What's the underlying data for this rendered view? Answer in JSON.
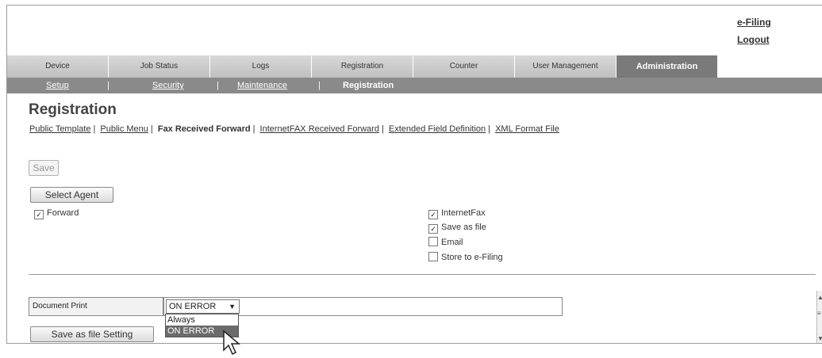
{
  "top_links": [
    "e-Filing",
    "Logout"
  ],
  "tabs": [
    "Device",
    "Job Status",
    "Logs",
    "Registration",
    "Counter",
    "User Management",
    "Administration"
  ],
  "subnav": [
    "Setup",
    "Security",
    "Maintenance",
    "Registration"
  ],
  "page_title": "Registration",
  "section_links": {
    "public_template": "Public Template",
    "public_menu": "Public Menu",
    "fax_received_forward": "Fax Received Forward",
    "internetfax_received_forward": "InternetFAX Received Forward",
    "extended_field_definition": "Extended Field Definition",
    "xml_format_file": "XML Format File"
  },
  "buttons": {
    "save": "Save",
    "select_agent": "Select Agent",
    "save_as_file_setting": "Save as file Setting"
  },
  "checkboxes": {
    "forward": {
      "label": "Forward",
      "checked": true
    },
    "internetfax": {
      "label": "InternetFax",
      "checked": true
    },
    "save_as_file": {
      "label": "Save as file",
      "checked": true
    },
    "email": {
      "label": "Email",
      "checked": false
    },
    "store_to_efiling": {
      "label": "Store to e-Filing",
      "checked": false
    }
  },
  "document_print": {
    "label": "Document Print",
    "selected": "ON ERROR",
    "options": [
      "Always",
      "ON ERROR"
    ]
  },
  "icons": {
    "dropdown_arrow": "▼",
    "check": "✓"
  },
  "colors": {
    "active_tab": "#7a7a7a",
    "subbar": "#8a8a8a"
  }
}
